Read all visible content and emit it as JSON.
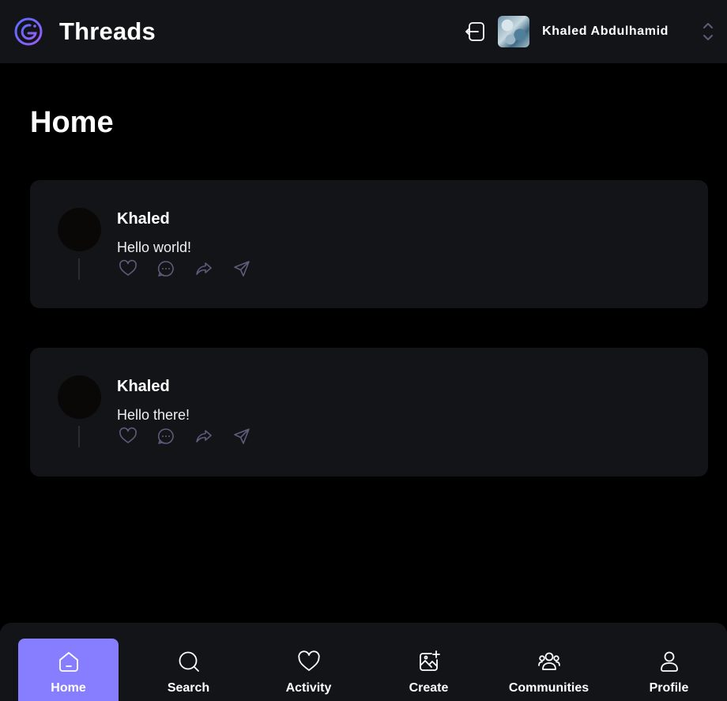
{
  "app": {
    "title": "Threads"
  },
  "account": {
    "name": "Khaled Abdulhamid"
  },
  "page": {
    "title": "Home"
  },
  "threads": [
    {
      "author": "Khaled",
      "text": "Hello world!"
    },
    {
      "author": "Khaled",
      "text": "Hello there!"
    }
  ],
  "bottom_nav": [
    {
      "label": "Home",
      "icon": "home-icon",
      "active": true
    },
    {
      "label": "Search",
      "icon": "search-icon"
    },
    {
      "label": "Activity",
      "icon": "heart-icon"
    },
    {
      "label": "Create",
      "icon": "image-plus-icon"
    },
    {
      "label": "Communities",
      "icon": "users-icon"
    },
    {
      "label": "Profile",
      "icon": "user-icon"
    }
  ],
  "colors": {
    "accent": "#877eff",
    "surface": "#121417",
    "background": "#000000",
    "icon_muted": "#5c5c7b"
  }
}
